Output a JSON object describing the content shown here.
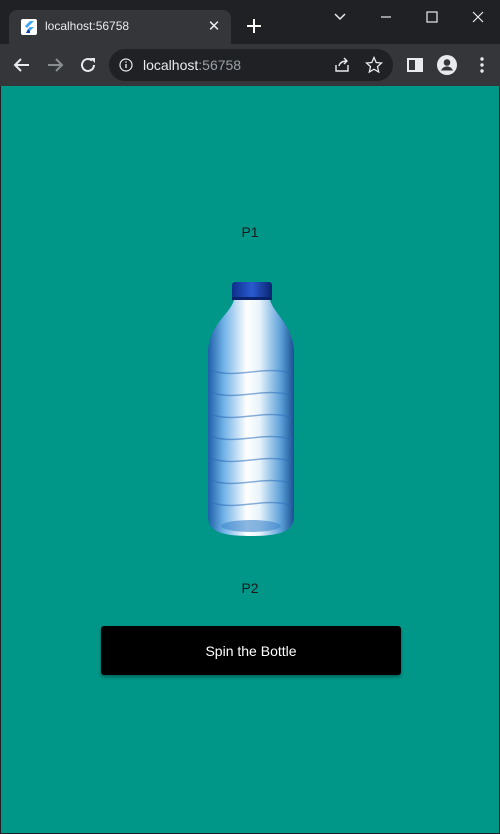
{
  "browser": {
    "tab": {
      "title": "localhost:56758",
      "favicon": "flutter-icon"
    },
    "address_bar": {
      "host": "localhost",
      "port": ":56758"
    }
  },
  "app": {
    "background": "#009688",
    "player_top": "P1",
    "player_bottom": "P2",
    "bottle_image": "water-bottle",
    "spin_button_label": "Spin the Bottle"
  }
}
